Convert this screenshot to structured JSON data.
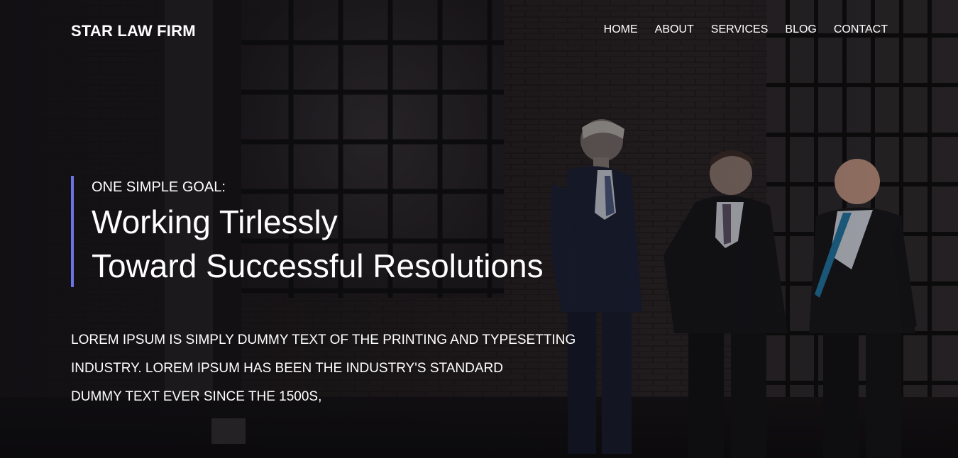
{
  "header": {
    "brand": "STAR LAW FIRM",
    "nav": [
      "HOME",
      "ABOUT",
      "SERVICES",
      "BLOG",
      "CONTACT"
    ]
  },
  "hero": {
    "kicker": "ONE SIMPLE GOAL:",
    "headline_lines": [
      "Working Tirlessly",
      "Toward Successful Resolutions"
    ],
    "body_lines": [
      "LOREM IPSUM IS SIMPLY DUMMY TEXT OF THE PRINTING AND TYPESETTING",
      "INDUSTRY. LOREM IPSUM HAS BEEN THE INDUSTRY'S STANDARD",
      "DUMMY TEXT EVER SINCE THE 1500S,"
    ]
  },
  "colors": {
    "accent": "#6b73e6",
    "text": "#ffffff",
    "background": "#141214"
  }
}
